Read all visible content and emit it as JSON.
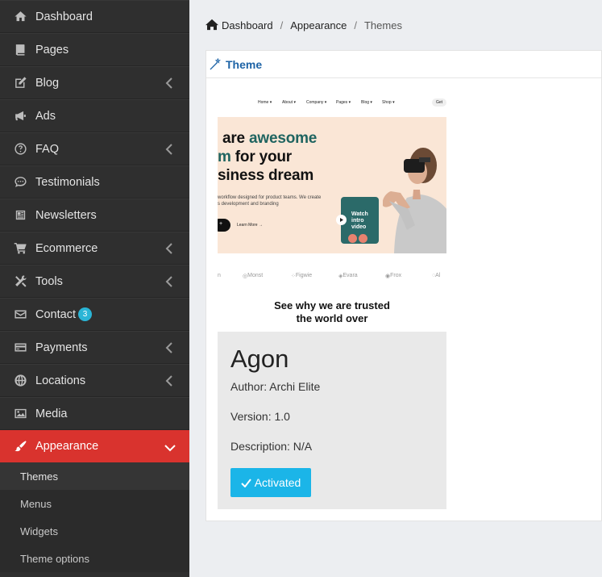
{
  "sidebar": {
    "items": [
      {
        "label": "Dashboard",
        "icon": "home-icon",
        "has_children": false
      },
      {
        "label": "Pages",
        "icon": "book-icon",
        "has_children": false
      },
      {
        "label": "Blog",
        "icon": "edit-icon",
        "has_children": true
      },
      {
        "label": "Ads",
        "icon": "bullhorn-icon",
        "has_children": false
      },
      {
        "label": "FAQ",
        "icon": "question-icon",
        "has_children": true
      },
      {
        "label": "Testimonials",
        "icon": "comment-icon",
        "has_children": false
      },
      {
        "label": "Newsletters",
        "icon": "newspaper-icon",
        "has_children": false
      },
      {
        "label": "Ecommerce",
        "icon": "cart-icon",
        "has_children": true
      },
      {
        "label": "Tools",
        "icon": "tools-icon",
        "has_children": true
      },
      {
        "label": "Contact",
        "icon": "envelope-icon",
        "badge": "3",
        "has_children": false
      },
      {
        "label": "Payments",
        "icon": "credit-card-icon",
        "has_children": true
      },
      {
        "label": "Locations",
        "icon": "globe-icon",
        "has_children": true
      },
      {
        "label": "Media",
        "icon": "image-icon",
        "has_children": false
      },
      {
        "label": "Appearance",
        "icon": "paint-brush-icon",
        "has_children": true,
        "expanded": true
      }
    ],
    "sub_items": [
      "Themes",
      "Menus",
      "Widgets",
      "Theme options"
    ],
    "active_color": "#d9332e"
  },
  "breadcrumb": {
    "items": [
      "Dashboard",
      "Appearance",
      "Themes"
    ]
  },
  "card": {
    "title": "Theme"
  },
  "preview": {
    "nav": [
      "Home ▾",
      "About ▾",
      "Company ▾",
      "Pages ▾",
      "Blog ▾",
      "Shop ▾"
    ],
    "nav_button": "Get",
    "hero_line1_a": "are ",
    "hero_line1_b": "awesome",
    "hero_line2_a": "m",
    "hero_line2_b": " for your",
    "hero_line3": "siness dream",
    "hero_text_1": "workflow designed for product teams. We create",
    "hero_text_2": "s development and branding",
    "learn_more": "Learn More →",
    "video_label_1": "Watch",
    "video_label_2": "intro",
    "video_label_3": "video",
    "logos": [
      "n",
      "Monst",
      "Figwie",
      "Evara",
      "Frox",
      "Al"
    ],
    "trusted_line1": "See why we are trusted",
    "trusted_line2": "the world over"
  },
  "theme": {
    "name": "Agon",
    "author": "Author: Archi Elite",
    "version": "Version: 1.0",
    "description": "Description: N/A",
    "button_label": "Activated",
    "button_color": "#1bb5e8"
  }
}
